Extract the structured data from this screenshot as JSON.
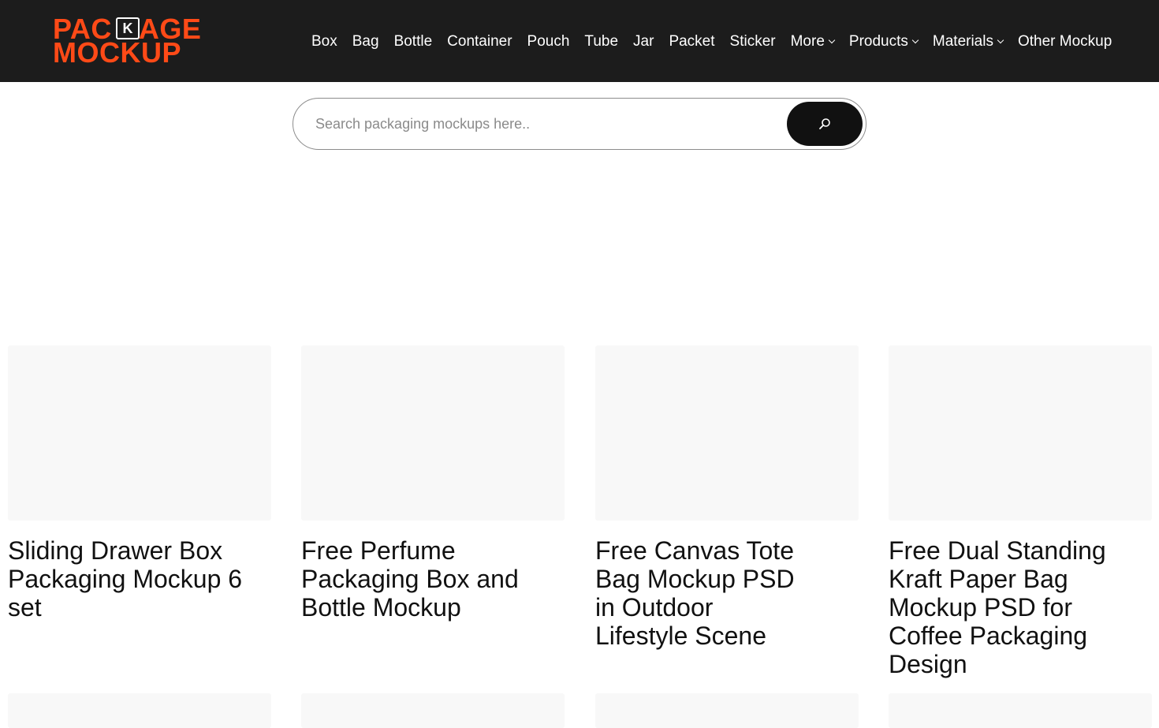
{
  "brand": {
    "logo_line1_a": "PAC",
    "logo_k": "K",
    "logo_line1_b": "AGE",
    "logo_line2": "MOCKUP",
    "accent_color": "#ff4a17"
  },
  "nav": {
    "items": [
      {
        "label": "Box"
      },
      {
        "label": "Bag"
      },
      {
        "label": "Bottle"
      },
      {
        "label": "Container"
      },
      {
        "label": "Pouch"
      },
      {
        "label": "Tube"
      },
      {
        "label": "Jar"
      },
      {
        "label": "Packet"
      },
      {
        "label": "Sticker"
      },
      {
        "label": "More",
        "dropdown": true
      },
      {
        "label": "Products",
        "dropdown": true
      },
      {
        "label": "Materials",
        "dropdown": true
      },
      {
        "label": "Other Mockup"
      }
    ]
  },
  "search": {
    "placeholder": "Search packaging mockups here..",
    "value": "",
    "button_icon": "search-icon"
  },
  "cards": [
    {
      "title": "Sliding Drawer Box Packaging Mockup 6 set"
    },
    {
      "title": "Free Perfume Packaging Box and Bottle Mockup"
    },
    {
      "title": "Free Canvas Tote Bag Mockup PSD in Outdoor Lifestyle Scene"
    },
    {
      "title": "Free Dual Standing Kraft Paper Bag Mockup PSD for Coffee Packaging Design"
    }
  ]
}
